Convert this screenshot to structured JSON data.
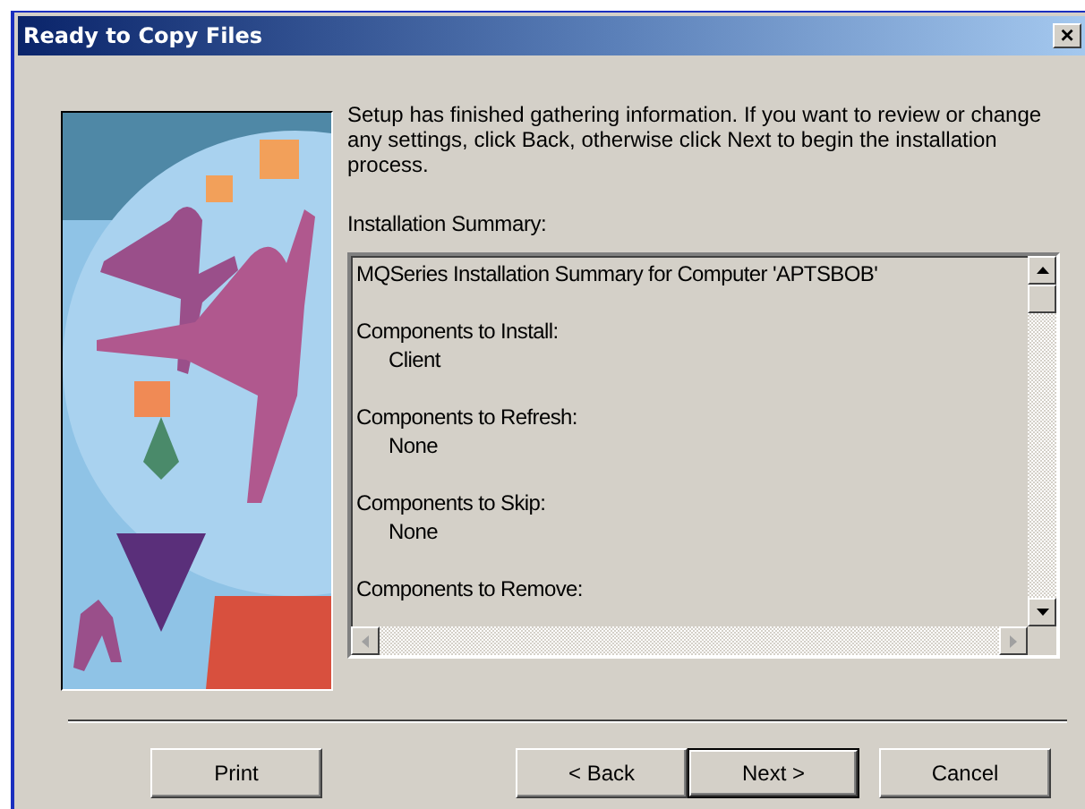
{
  "window": {
    "title": "Ready to Copy Files",
    "close": "×"
  },
  "intro": "Setup has finished gathering information.  If you want to review or change any settings, click Back, otherwise click Next to begin the installation process.",
  "summary": {
    "label": "Installation Summary:",
    "lines": [
      {
        "kind": "heading",
        "text": "MQSeries Installation Summary for Computer 'APTSBOB'"
      },
      {
        "kind": "heading",
        "text": "Components to Install:"
      },
      {
        "kind": "item",
        "text": "Client"
      },
      {
        "kind": "heading",
        "text": "Components to Refresh:"
      },
      {
        "kind": "item",
        "text": "None"
      },
      {
        "kind": "heading",
        "text": "Components to Skip:"
      },
      {
        "kind": "item",
        "text": "None"
      },
      {
        "kind": "heading",
        "text": "Components to Remove:"
      }
    ]
  },
  "buttons": [
    {
      "label": "Print",
      "default": false
    },
    {
      "label": "< Back",
      "default": false
    },
    {
      "label": "Next >",
      "default": true
    },
    {
      "label": "Cancel",
      "default": false
    }
  ]
}
